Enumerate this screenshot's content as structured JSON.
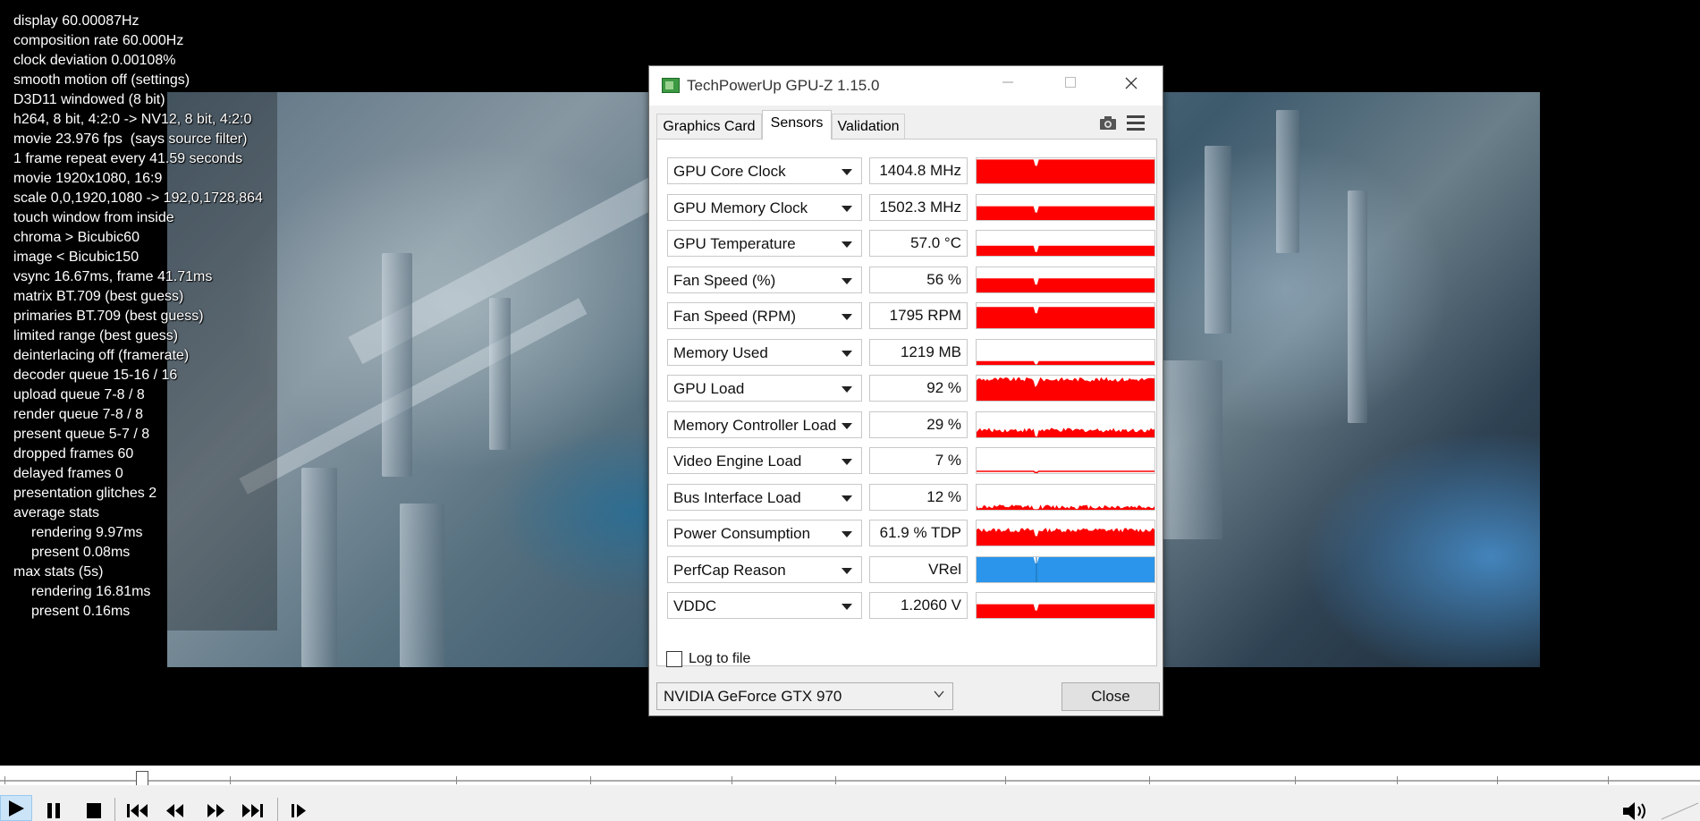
{
  "osd": {
    "lines": [
      {
        "text": "display 60.00087Hz",
        "indent": false
      },
      {
        "text": "composition rate 60.000Hz",
        "indent": false
      },
      {
        "text": "clock deviation 0.00108%",
        "indent": false
      },
      {
        "text": "smooth motion off (settings)",
        "indent": false
      },
      {
        "text": "D3D11 windowed (8 bit)",
        "indent": false
      },
      {
        "text": "h264, 8 bit, 4:2:0 -> NV12, 8 bit, 4:2:0",
        "indent": false
      },
      {
        "text": "movie 23.976 fps  (says source filter)",
        "indent": false
      },
      {
        "text": "1 frame repeat every 41.59 seconds",
        "indent": false
      },
      {
        "text": "movie 1920x1080, 16:9",
        "indent": false
      },
      {
        "text": "scale 0,0,1920,1080 -> 192,0,1728,864",
        "indent": false
      },
      {
        "text": "touch window from inside",
        "indent": false
      },
      {
        "text": "chroma > Bicubic60",
        "indent": false
      },
      {
        "text": "image < Bicubic150",
        "indent": false
      },
      {
        "text": "vsync 16.67ms, frame 41.71ms",
        "indent": false
      },
      {
        "text": "matrix BT.709 (best guess)",
        "indent": false
      },
      {
        "text": "primaries BT.709 (best guess)",
        "indent": false
      },
      {
        "text": "limited range (best guess)",
        "indent": false
      },
      {
        "text": "deinterlacing off (framerate)",
        "indent": false
      },
      {
        "text": "decoder queue 15-16 / 16",
        "indent": false
      },
      {
        "text": "upload queue 7-8 / 8",
        "indent": false
      },
      {
        "text": "render queue 7-8 / 8",
        "indent": false
      },
      {
        "text": "present queue 5-7 / 8",
        "indent": false
      },
      {
        "text": "dropped frames 60",
        "indent": false
      },
      {
        "text": "delayed frames 0",
        "indent": false
      },
      {
        "text": "presentation glitches 2",
        "indent": false
      },
      {
        "text": "average stats",
        "indent": false
      },
      {
        "text": "rendering 9.97ms",
        "indent": true
      },
      {
        "text": "present 0.08ms",
        "indent": true
      },
      {
        "text": "max stats (5s)",
        "indent": false
      },
      {
        "text": "rendering 16.81ms",
        "indent": true
      },
      {
        "text": "present 0.16ms",
        "indent": true
      }
    ]
  },
  "gpuz": {
    "title": "TechPowerUp GPU-Z 1.15.0",
    "tabs": [
      {
        "label": "Graphics Card",
        "active": false
      },
      {
        "label": "Sensors",
        "active": true
      },
      {
        "label": "Validation",
        "active": false
      }
    ],
    "sensors": [
      {
        "name": "GPU Core Clock",
        "value": "1404.8 MHz",
        "level": 0.95,
        "style": "solid",
        "color": "#ff0000"
      },
      {
        "name": "GPU Memory Clock",
        "value": "1502.3 MHz",
        "level": 0.55,
        "style": "solid",
        "color": "#ff0000"
      },
      {
        "name": "GPU Temperature",
        "value": "57.0 °C",
        "level": 0.4,
        "style": "solid",
        "color": "#ff0000"
      },
      {
        "name": "Fan Speed (%)",
        "value": "56 %",
        "level": 0.56,
        "style": "solid",
        "color": "#ff0000"
      },
      {
        "name": "Fan Speed (RPM)",
        "value": "1795 RPM",
        "level": 0.85,
        "style": "solid",
        "color": "#ff0000"
      },
      {
        "name": "Memory Used",
        "value": "1219 MB",
        "level": 0.15,
        "style": "solid",
        "color": "#ff0000"
      },
      {
        "name": "GPU Load",
        "value": "92 %",
        "level": 0.85,
        "style": "noisy",
        "color": "#ff0000"
      },
      {
        "name": "Memory Controller Load",
        "value": "29 %",
        "level": 0.29,
        "style": "noisy",
        "color": "#ff0000"
      },
      {
        "name": "Video Engine Load",
        "value": "7 %",
        "level": 0.07,
        "style": "line",
        "color": "#ff0000"
      },
      {
        "name": "Bus Interface Load",
        "value": "12 %",
        "level": 0.12,
        "style": "noisy",
        "color": "#ff0000"
      },
      {
        "name": "Power Consumption",
        "value": "61.9 % TDP",
        "level": 0.62,
        "style": "noisy",
        "color": "#ff0000"
      },
      {
        "name": "PerfCap Reason",
        "value": "VRel",
        "level": 1.0,
        "style": "solid",
        "color": "#2a95ea"
      },
      {
        "name": "VDDC",
        "value": "1.2060 V",
        "level": 0.55,
        "style": "solid",
        "color": "#ff0000"
      }
    ],
    "log_label": "Log to file",
    "log_checked": false,
    "gpu_name": "NVIDIA GeForce GTX 970",
    "close_label": "Close"
  },
  "player": {
    "controls": [
      "play-icon",
      "pause-icon",
      "stop-icon",
      "skip-back-icon",
      "rewind-icon",
      "fast-forward-icon",
      "skip-forward-icon",
      "frame-step-icon",
      "volume-icon"
    ],
    "playback_state": "playing",
    "seek_position": 0.08
  }
}
